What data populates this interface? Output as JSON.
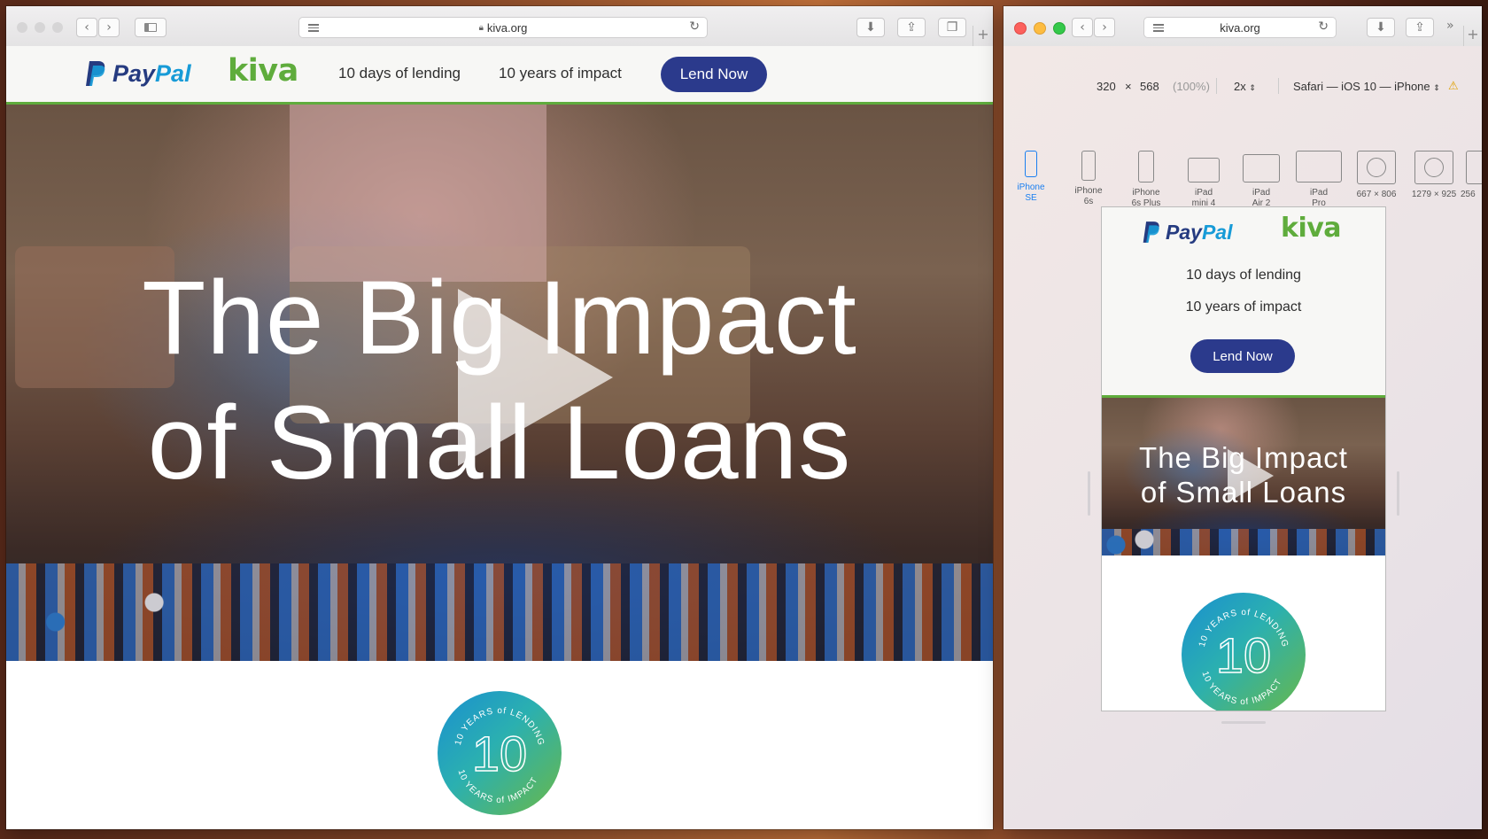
{
  "browser": {
    "url": "kiva.org"
  },
  "site": {
    "paypal_logo": "PayPal",
    "kiva_logo": "kiva",
    "nav": [
      "10 days of lending",
      "10 years of impact"
    ],
    "cta": "Lend Now",
    "hero_title_line1": "The Big Impact",
    "hero_title_line2": "of Small Loans",
    "badge_top_text": "10 YEARS of LENDING",
    "badge_bottom_text": "10 YEARS of IMPACT",
    "badge_number": "10"
  },
  "responsive": {
    "url": "kiva.org",
    "dimensions_w": "320",
    "dimensions_x": "×",
    "dimensions_h": "568",
    "zoom": "(100%)",
    "scale": "2x",
    "user_agent": "Safari — iOS 10 — iPhone",
    "devices": [
      {
        "line1": "iPhone",
        "line2": "SE"
      },
      {
        "line1": "iPhone",
        "line2": "6s"
      },
      {
        "line1": "iPhone",
        "line2": "6s Plus"
      },
      {
        "line1": "iPad",
        "line2": "mini 4"
      },
      {
        "line1": "iPad",
        "line2": "Air 2"
      },
      {
        "line1": "iPad",
        "line2": "Pro"
      },
      {
        "line1": "667 × 806",
        "line2": ""
      },
      {
        "line1": "1279 × 925",
        "line2": ""
      },
      {
        "line1": "256",
        "line2": ""
      }
    ]
  },
  "colors": {
    "kiva_green": "#5fac3c",
    "lend_blue": "#2b3a8c",
    "paypal_dark": "#253b80",
    "paypal_light": "#179bd7",
    "selected_device": "#1a7ff0"
  }
}
